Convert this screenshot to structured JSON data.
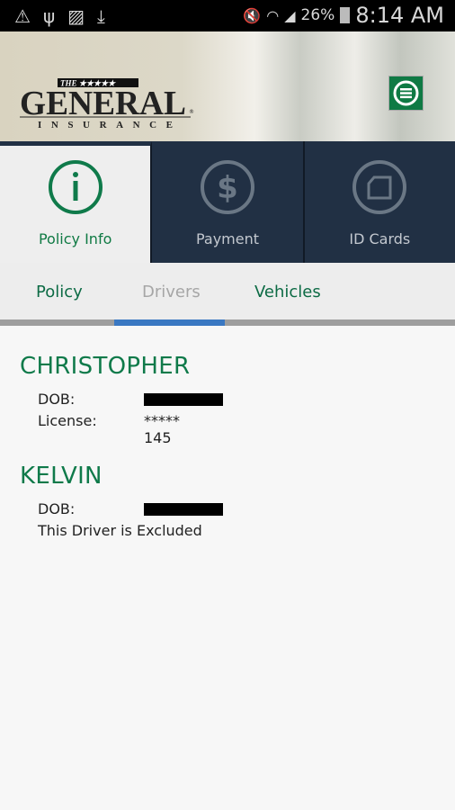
{
  "status_bar": {
    "icons": [
      "warning-icon",
      "usb-icon",
      "image-icon",
      "download-icon",
      "mute-icon",
      "wifi-icon",
      "signal-icon",
      "battery-charging-icon"
    ],
    "battery": "26%",
    "time": "8:14 AM"
  },
  "header": {
    "logo_text": "THE GENERAL INSURANCE",
    "menu_icon": "menu-icon",
    "brand_color": "#0f7a44"
  },
  "tabs": [
    {
      "label": "Policy Info",
      "icon": "info-icon",
      "active": true
    },
    {
      "label": "Payment",
      "icon": "dollar-icon",
      "active": false
    },
    {
      "label": "ID Cards",
      "icon": "id-card-icon",
      "active": false
    }
  ],
  "subtabs": [
    {
      "label": "Policy"
    },
    {
      "label": "Drivers",
      "selected": true
    },
    {
      "label": "Vehicles"
    }
  ],
  "drivers": [
    {
      "name": "CHRISTOPHER",
      "dob_label": "DOB:",
      "license_label": "License:",
      "license_value": "***** 145"
    },
    {
      "name": "KELVIN",
      "dob_label": "DOB:",
      "note": "This Driver is Excluded"
    }
  ]
}
